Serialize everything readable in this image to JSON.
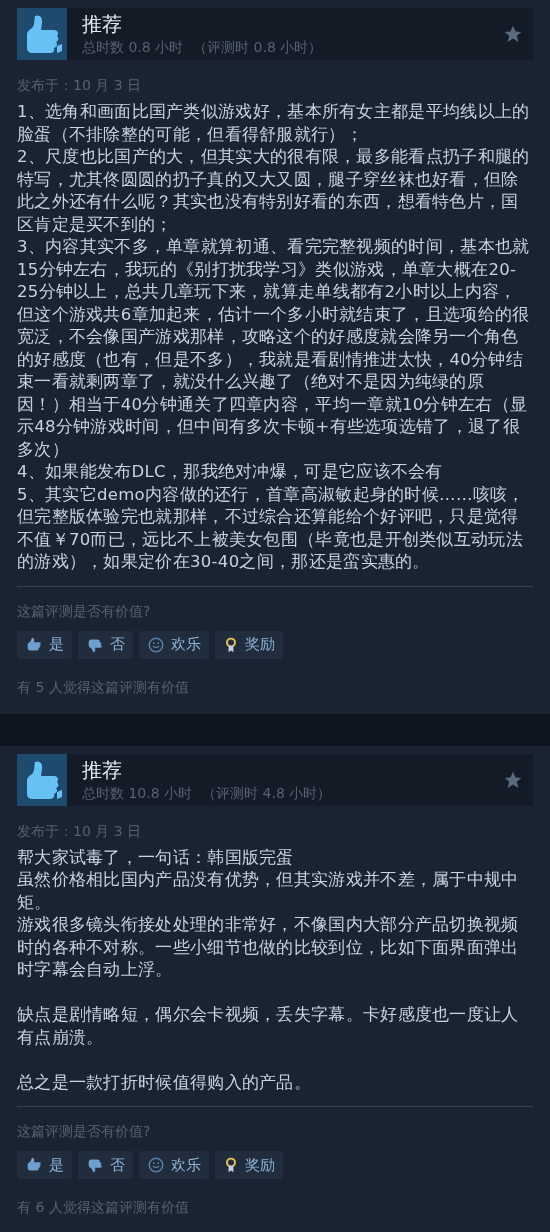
{
  "reviews": [
    {
      "verdict": "推荐",
      "hours": "总时数 0.8 小时",
      "hours_at_review": "（评测时 0.8 小时）",
      "posted": "发布于：10 月 3 日",
      "body_blocks": [
        [
          "1、选角和画面比国产类似游戏好，基本所有女主都是平均线以上的脸蛋（不排除整的可能，但看得舒服就行）；",
          "2、尺度也比国产的大，但其实大的很有限，最多能看点扔子和腿的特写，尤其佟圆圆的扔子真的又大又圆，腿子穿丝袜也好看，但除此之外还有什么呢？其实也没有特别好看的东西，想看特色片，国区肯定是买不到的；",
          "3、内容其实不多，单章就算初通、看完完整视频的时间，基本也就15分钟左右，我玩的《别打扰我学习》类似游戏，单章大概在20-25分钟以上，总共几章玩下来，就算走单线都有2小时以上内容，但这个游戏共6章加起来，估计一个多小时就结束了，且选项给的很宽泛，不会像国产游戏那样，攻略这个的好感度就会降另一个角色的好感度（也有，但是不多），我就是看剧情推进太快，40分钟结束一看就剩两章了，就没什么兴趣了（绝对不是因为纯绿的原因！）相当于40分钟通关了四章内容，平均一章就10分钟左右（显示48分钟游戏时间，但中间有多次卡顿+有些选项选错了，退了很多次）",
          "4、如果能发布DLC，那我绝对冲爆，可是它应该不会有",
          "5、其实它demo内容做的还行，首章高淑敏起身的时候……咳咳，但完整版体验完也就那样，不过综合还算能给个好评吧，只是觉得不值￥70而已，远比不上被美女包围（毕竟也是开创类似互动玩法的游戏），如果定价在30-40之间，那还是蛮实惠的。"
        ]
      ],
      "helpful_prompt": "这篇评测是否有价值?",
      "buttons": [
        {
          "kind": "yes",
          "label": "是"
        },
        {
          "kind": "no",
          "label": "否"
        },
        {
          "kind": "funny",
          "label": "欢乐"
        },
        {
          "kind": "award",
          "label": "奖励"
        }
      ],
      "helpful_count": "有 5 人觉得这篇评测有价值"
    },
    {
      "verdict": "推荐",
      "hours": "总时数 10.8 小时",
      "hours_at_review": "（评测时 4.8 小时）",
      "posted": "发布于：10 月 3 日",
      "body_blocks": [
        [
          "帮大家试毒了，一句话：韩国版完蛋",
          "虽然价格相比国内产品没有优势，但其实游戏并不差，属于中规中矩。",
          "游戏很多镜头衔接处处理的非常好，不像国内大部分产品切换视频时的各种不对称。一些小细节也做的比较到位，比如下面界面弹出时字幕会自动上浮。"
        ],
        [
          "缺点是剧情略短，偶尔会卡视频，丢失字幕。卡好感度也一度让人有点崩溃。"
        ],
        [
          "总之是一款打折时候值得购入的产品。"
        ]
      ],
      "helpful_prompt": "这篇评测是否有价值?",
      "buttons": [
        {
          "kind": "yes",
          "label": "是"
        },
        {
          "kind": "no",
          "label": "否"
        },
        {
          "kind": "funny",
          "label": "欢乐"
        },
        {
          "kind": "award",
          "label": "奖励"
        }
      ],
      "helpful_count": "有 6 人觉得这篇评测有价值"
    }
  ]
}
